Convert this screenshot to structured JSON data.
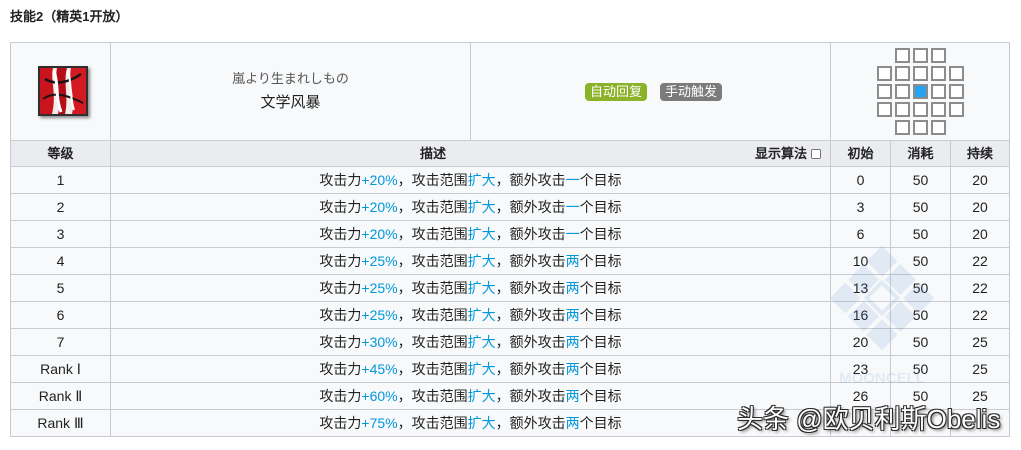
{
  "section_title": "技能2（精英1开放）",
  "skill": {
    "icon": "skill-icon",
    "subtitle": "嵐より生まれしもの",
    "name": "文学风暴",
    "tags": [
      {
        "label": "自动回复",
        "color": "#8cb22a"
      },
      {
        "label": "手动触发",
        "color": "#7b7b7b"
      }
    ],
    "attack_range": [
      [
        "none",
        "cell",
        "cell",
        "cell",
        "none"
      ],
      [
        "cell",
        "cell",
        "cell",
        "cell",
        "cell"
      ],
      [
        "cell",
        "cell",
        "self",
        "cell",
        "cell"
      ],
      [
        "cell",
        "cell",
        "cell",
        "cell",
        "cell"
      ],
      [
        "none",
        "cell",
        "cell",
        "cell",
        "none"
      ]
    ]
  },
  "table": {
    "headers": {
      "level": "等级",
      "description": "描述",
      "show_formula": "显示算法",
      "initial": "初始",
      "cost": "消耗",
      "duration": "持续"
    },
    "show_formula_checked": false,
    "rows": [
      {
        "level": "1",
        "initial": "0",
        "cost": "50",
        "duration": "20",
        "desc": [
          {
            "text": "攻击力",
            "hl": false
          },
          {
            "text": "+20%",
            "hl": true
          },
          {
            "text": "，攻击范围",
            "hl": false
          },
          {
            "text": "扩大",
            "hl": true
          },
          {
            "text": "，额外攻击",
            "hl": false
          },
          {
            "text": "一",
            "hl": true
          },
          {
            "text": "个目标",
            "hl": false
          }
        ]
      },
      {
        "level": "2",
        "initial": "3",
        "cost": "50",
        "duration": "20",
        "desc": [
          {
            "text": "攻击力",
            "hl": false
          },
          {
            "text": "+20%",
            "hl": true
          },
          {
            "text": "，攻击范围",
            "hl": false
          },
          {
            "text": "扩大",
            "hl": true
          },
          {
            "text": "，额外攻击",
            "hl": false
          },
          {
            "text": "一",
            "hl": true
          },
          {
            "text": "个目标",
            "hl": false
          }
        ]
      },
      {
        "level": "3",
        "initial": "6",
        "cost": "50",
        "duration": "20",
        "desc": [
          {
            "text": "攻击力",
            "hl": false
          },
          {
            "text": "+20%",
            "hl": true
          },
          {
            "text": "，攻击范围",
            "hl": false
          },
          {
            "text": "扩大",
            "hl": true
          },
          {
            "text": "，额外攻击",
            "hl": false
          },
          {
            "text": "一",
            "hl": true
          },
          {
            "text": "个目标",
            "hl": false
          }
        ]
      },
      {
        "level": "4",
        "initial": "10",
        "cost": "50",
        "duration": "22",
        "desc": [
          {
            "text": "攻击力",
            "hl": false
          },
          {
            "text": "+25%",
            "hl": true
          },
          {
            "text": "，攻击范围",
            "hl": false
          },
          {
            "text": "扩大",
            "hl": true
          },
          {
            "text": "，额外攻击",
            "hl": false
          },
          {
            "text": "两",
            "hl": true
          },
          {
            "text": "个目标",
            "hl": false
          }
        ]
      },
      {
        "level": "5",
        "initial": "13",
        "cost": "50",
        "duration": "22",
        "desc": [
          {
            "text": "攻击力",
            "hl": false
          },
          {
            "text": "+25%",
            "hl": true
          },
          {
            "text": "，攻击范围",
            "hl": false
          },
          {
            "text": "扩大",
            "hl": true
          },
          {
            "text": "，额外攻击",
            "hl": false
          },
          {
            "text": "两",
            "hl": true
          },
          {
            "text": "个目标",
            "hl": false
          }
        ]
      },
      {
        "level": "6",
        "initial": "16",
        "cost": "50",
        "duration": "22",
        "desc": [
          {
            "text": "攻击力",
            "hl": false
          },
          {
            "text": "+25%",
            "hl": true
          },
          {
            "text": "，攻击范围",
            "hl": false
          },
          {
            "text": "扩大",
            "hl": true
          },
          {
            "text": "，额外攻击",
            "hl": false
          },
          {
            "text": "两",
            "hl": true
          },
          {
            "text": "个目标",
            "hl": false
          }
        ]
      },
      {
        "level": "7",
        "initial": "20",
        "cost": "50",
        "duration": "25",
        "desc": [
          {
            "text": "攻击力",
            "hl": false
          },
          {
            "text": "+30%",
            "hl": true
          },
          {
            "text": "，攻击范围",
            "hl": false
          },
          {
            "text": "扩大",
            "hl": true
          },
          {
            "text": "，额外攻击",
            "hl": false
          },
          {
            "text": "两",
            "hl": true
          },
          {
            "text": "个目标",
            "hl": false
          }
        ]
      },
      {
        "level": "Rank Ⅰ",
        "initial": "23",
        "cost": "50",
        "duration": "25",
        "desc": [
          {
            "text": "攻击力",
            "hl": false
          },
          {
            "text": "+45%",
            "hl": true
          },
          {
            "text": "，攻击范围",
            "hl": false
          },
          {
            "text": "扩大",
            "hl": true
          },
          {
            "text": "，额外攻击",
            "hl": false
          },
          {
            "text": "两",
            "hl": true
          },
          {
            "text": "个目标",
            "hl": false
          }
        ]
      },
      {
        "level": "Rank Ⅱ",
        "initial": "26",
        "cost": "50",
        "duration": "25",
        "desc": [
          {
            "text": "攻击力",
            "hl": false
          },
          {
            "text": "+60%",
            "hl": true
          },
          {
            "text": "，攻击范围",
            "hl": false
          },
          {
            "text": "扩大",
            "hl": true
          },
          {
            "text": "，额外攻击",
            "hl": false
          },
          {
            "text": "两",
            "hl": true
          },
          {
            "text": "个目标",
            "hl": false
          }
        ]
      },
      {
        "level": "Rank Ⅲ",
        "desc": [
          {
            "text": "攻击力",
            "hl": false
          },
          {
            "text": "+75%",
            "hl": true
          },
          {
            "text": "，攻击范围",
            "hl": false
          },
          {
            "text": "扩大",
            "hl": true
          },
          {
            "text": "，额外攻击",
            "hl": false
          },
          {
            "text": "两",
            "hl": true
          },
          {
            "text": "个目标",
            "hl": false
          }
        ]
      }
    ]
  },
  "colors": {
    "highlight": "#0098dc",
    "range_self": "#27a2f0"
  },
  "watermarks": {
    "overlay": "头条 @欧贝利斯Obelis",
    "background_logo": "MOONCELL"
  }
}
